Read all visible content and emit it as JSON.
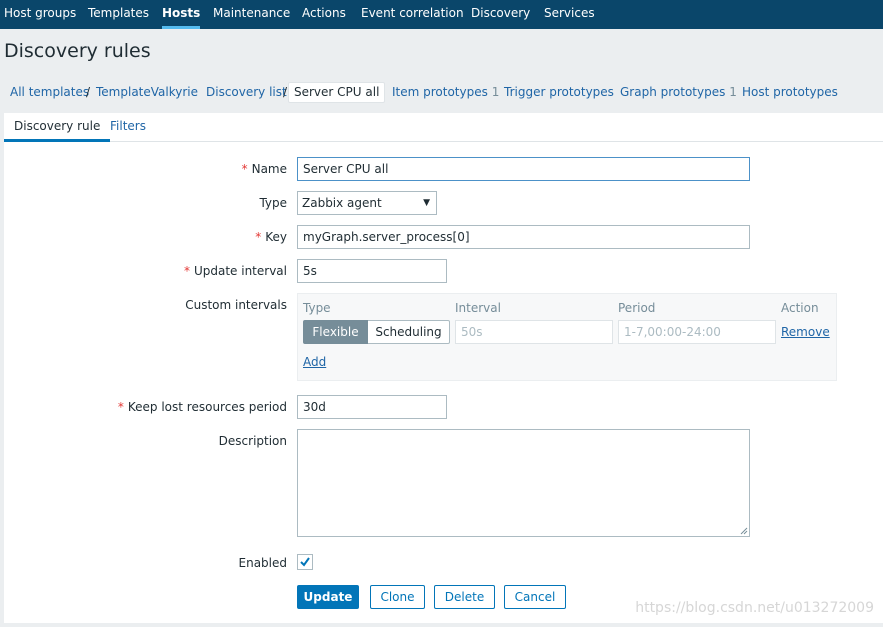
{
  "topnav": {
    "items": [
      "Host groups",
      "Templates",
      "Hosts",
      "Maintenance",
      "Actions",
      "Event correlation",
      "Discovery",
      "Services"
    ],
    "active": "Hosts"
  },
  "page": {
    "title": "Discovery rules"
  },
  "breadcrumb": {
    "all_templates": "All templates",
    "separator": "/",
    "template": "TemplateValkyrie",
    "discovery_list": "Discovery list",
    "current": "Server CPU all",
    "item_prototypes": {
      "label": "Item prototypes",
      "count": "1"
    },
    "trigger_prototypes": "Trigger prototypes",
    "graph_prototypes": {
      "label": "Graph prototypes",
      "count": "1"
    },
    "host_prototypes": "Host prototypes"
  },
  "tabs": [
    {
      "label": "Discovery rule",
      "active": true
    },
    {
      "label": "Filters",
      "active": false
    }
  ],
  "form": {
    "required_marker": "*",
    "name": {
      "label": "Name",
      "value": "Server CPU all"
    },
    "type": {
      "label": "Type",
      "value": "Zabbix agent"
    },
    "key": {
      "label": "Key",
      "value": "myGraph.server_process[0]"
    },
    "update_interval": {
      "label": "Update interval",
      "value": "5s"
    },
    "custom_intervals": {
      "label": "Custom intervals",
      "headers": {
        "type": "Type",
        "interval": "Interval",
        "period": "Period",
        "action": "Action"
      },
      "row": {
        "flexible": "Flexible",
        "scheduling": "Scheduling",
        "selected_type": "Flexible",
        "interval_placeholder": "50s",
        "period_placeholder": "1-7,00:00-24:00",
        "remove": "Remove"
      },
      "add": "Add"
    },
    "keep_lost": {
      "label": "Keep lost resources period",
      "value": "30d"
    },
    "description": {
      "label": "Description",
      "value": ""
    },
    "enabled": {
      "label": "Enabled",
      "checked": true
    }
  },
  "buttons": {
    "update": "Update",
    "clone": "Clone",
    "delete": "Delete",
    "cancel": "Cancel"
  },
  "watermark": "https://blog.csdn.net/u013272009",
  "colors": {
    "topnav_bg": "#0a466a",
    "accent": "#0275b8",
    "link": "#1f65a6",
    "required": "#e33734",
    "background": "#ebeef0"
  },
  "icons": {
    "dropdown": "chevron-down-icon",
    "checkbox_check": "checkmark-icon",
    "resize": "resize-grip-icon"
  }
}
